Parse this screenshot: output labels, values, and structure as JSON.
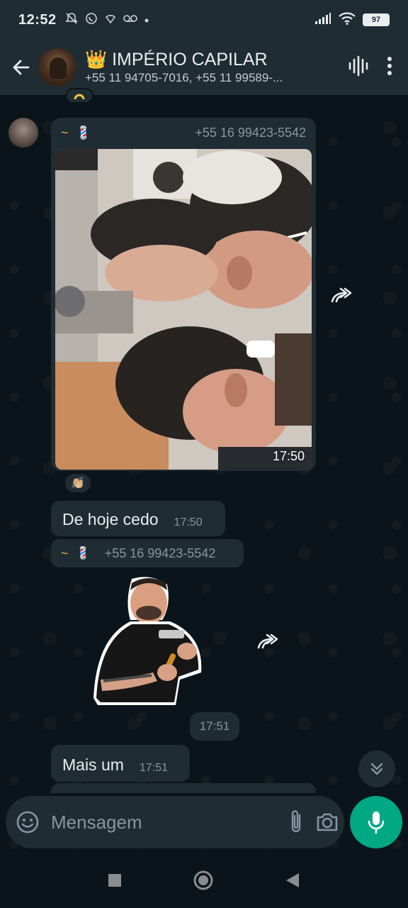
{
  "status_bar": {
    "time": "12:52",
    "battery": "97"
  },
  "header": {
    "crown": "👑",
    "group_name": "IMPÉRIO CAPILAR",
    "members": "+55 11 94705-7016, +55 11 99589-..."
  },
  "messages": {
    "image_message": {
      "sender_tilde": "~",
      "sender_emoji": "💈",
      "sender_phone": "+55 16 99423-5542",
      "time": "17:50",
      "reaction": "👏🏼"
    },
    "text_1": {
      "text": "De hoje cedo",
      "time": "17:50"
    },
    "sticker_message": {
      "sender_tilde": "~",
      "sender_emoji": "💈",
      "sender_phone": "+55 16 99423-5542",
      "time": "17:51"
    },
    "text_2": {
      "text": "Mais um",
      "time": "17:51"
    }
  },
  "input": {
    "placeholder": "Mensagem"
  },
  "colors": {
    "background": "#0b141a",
    "bubble": "#1f2c33",
    "accent": "#00a884",
    "muted_text": "#8696a0"
  },
  "icons": [
    "back-arrow-icon",
    "voice-call-icon",
    "more-options-icon",
    "forward-icon",
    "scroll-down-icon",
    "emoji-icon",
    "attach-icon",
    "camera-icon",
    "mic-icon"
  ]
}
